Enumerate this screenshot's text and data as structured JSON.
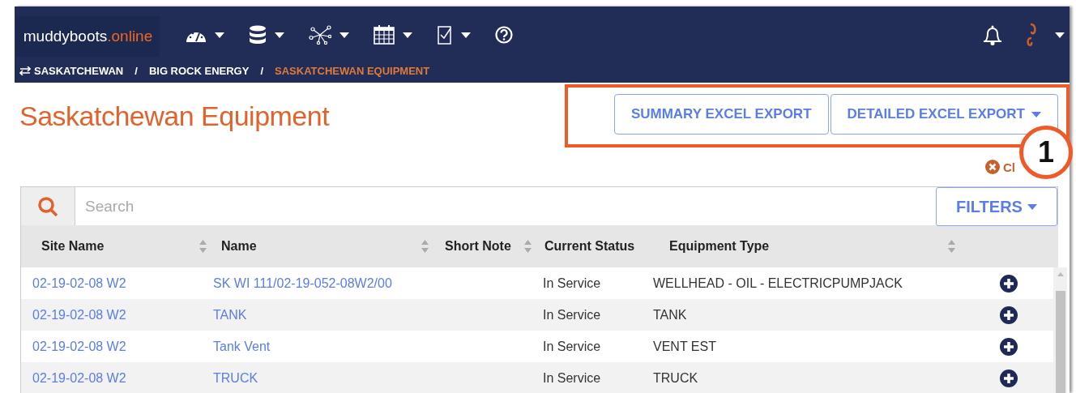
{
  "brand": {
    "name": "muddyboots",
    "suffix": ".online"
  },
  "nav_icons": [
    {
      "kind": "gauge",
      "dropdown": true
    },
    {
      "kind": "database",
      "dropdown": true
    },
    {
      "kind": "network",
      "dropdown": true
    },
    {
      "kind": "calendar",
      "dropdown": true
    },
    {
      "kind": "checklist",
      "dropdown": true
    },
    {
      "kind": "help",
      "dropdown": false
    }
  ],
  "breadcrumbs": [
    {
      "label": "SASKATCHEWAN",
      "selected": false
    },
    {
      "label": "BIG ROCK ENERGY",
      "selected": false
    },
    {
      "label": "SASKATCHEWAN EQUIPMENT",
      "selected": true
    }
  ],
  "breadcrumb_separator": "/",
  "page_title": "Saskatchewan Equipment",
  "export_buttons": [
    {
      "label": "SUMMARY EXCEL EXPORT",
      "dropdown": false
    },
    {
      "label": "DETAILED EXCEL EXPORT",
      "dropdown": true
    }
  ],
  "callout": {
    "number": "1"
  },
  "clear_link": "Cl",
  "search": {
    "placeholder": "Search"
  },
  "filters_button": "FILTERS",
  "table": {
    "columns": [
      {
        "label": "Site Name",
        "sortable": true
      },
      {
        "label": "Name",
        "sortable": true
      },
      {
        "label": "Short Note",
        "sortable": true
      },
      {
        "label": "Current Status",
        "sortable": false
      },
      {
        "label": "Equipment Type",
        "sortable": true
      }
    ],
    "rows": [
      {
        "site": "02-19-02-08 W2",
        "name": "SK WI 111/02-19-052-08W2/00",
        "note": "",
        "status": "In Service",
        "type": "WELLHEAD - OIL - ELECTRICPUMPJACK"
      },
      {
        "site": "02-19-02-08 W2",
        "name": "TANK",
        "note": "",
        "status": "In Service",
        "type": "TANK"
      },
      {
        "site": "02-19-02-08 W2",
        "name": "Tank Vent",
        "note": "",
        "status": "In Service",
        "type": "VENT EST"
      },
      {
        "site": "02-19-02-08 W2",
        "name": "TRUCK",
        "note": "",
        "status": "In Service",
        "type": "TRUCK"
      }
    ]
  }
}
